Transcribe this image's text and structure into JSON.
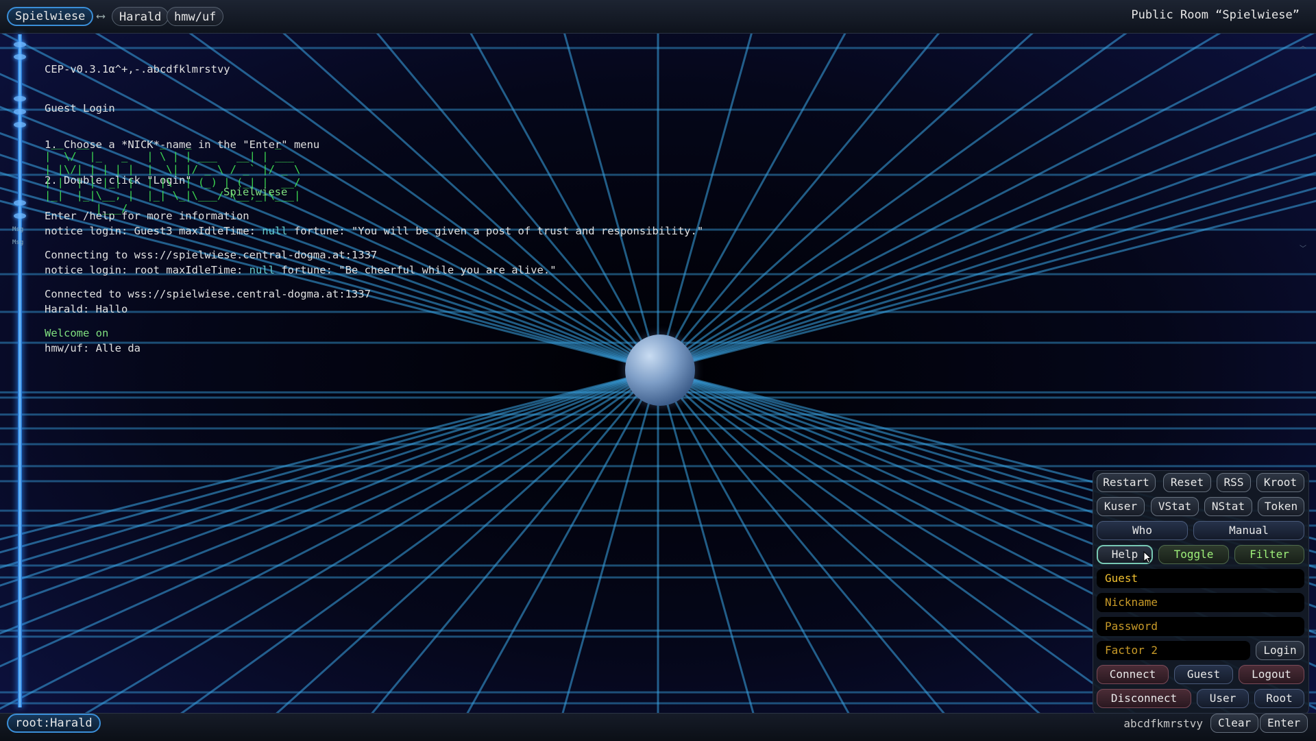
{
  "tabs": [
    {
      "label": "Spielwiese",
      "active": true
    },
    {
      "label": "Harald",
      "active": false
    },
    {
      "label": "hmw/uf",
      "active": false
    }
  ],
  "room_title": "Public Room “Spielwiese”",
  "log": [
    {
      "text": "CEP-v0.3.1α^+,-.abcdfklmrstvy"
    },
    {
      "text": "Guest Login"
    },
    {
      "text": "1. Choose a *NICK*-name in the \"Enter\" menu"
    },
    {
      "text": "2. Double click \"Login\""
    },
    {
      "text": "Enter /help for more information"
    },
    {
      "text": "Connecting to wss://spielwiese.central-dogma.at:1337"
    },
    {
      "text": "Connected to wss://spielwiese.central-dogma.at:1337"
    },
    {
      "text": "Welcome on"
    }
  ],
  "ascii_art": " __  __           _   _             _        \n|  \\/  |_   _   | \\ | | ___   __| | ___ \n| |\\/| | | | |  |  \\| |/ _ \\ / _` |/ _ \\\n| |  | | |_| |  | |\\  | (_) | (_| |  __/\n|_|  |_|\\__, |  |_| \\_|\\___/ \\__,_|\\___|\n        |___/",
  "ascii_room": "Spielwiese",
  "notices": [
    {
      "prefix": "notice login: Guest3 maxIdleTime: ",
      "null": "null",
      "rest": " fortune: \"You will be given a post of trust and responsibility.\""
    },
    {
      "prefix": "notice login: root maxIdleTime: ",
      "null": "null",
      "rest": " fortune: \"Be cheerful while you are alive.\""
    }
  ],
  "messages": [
    {
      "tag": "Msg",
      "text": "Harald: Hallo"
    },
    {
      "tag": "Msg",
      "text": "hmw/uf: Alle da"
    }
  ],
  "panel": {
    "row1": [
      "Restart",
      "Reset",
      "RSS",
      "Kroot"
    ],
    "row2": [
      "Kuser",
      "VStat",
      "NStat",
      "Token"
    ],
    "row3": [
      "Who",
      "Manual"
    ],
    "row4": [
      "Help",
      "Toggle",
      "Filter"
    ],
    "guest_value": "Guest",
    "nickname_placeholder": "Nickname",
    "password_placeholder": "Password",
    "factor2_placeholder": "Factor 2",
    "login": "Login",
    "row_connect": [
      "Connect",
      "Guest",
      "Logout"
    ],
    "row_disconnect": [
      "Disconnect",
      "User",
      "Root"
    ]
  },
  "bottom": {
    "user": "root:Harald",
    "charset": "abcdfkmrstvy",
    "clear": "Clear",
    "enter": "Enter"
  },
  "colors": {
    "accent": "#3b8fd9",
    "grid": "#3aa6e6",
    "ascii": "#3ee053",
    "guest": "#f0c030"
  }
}
